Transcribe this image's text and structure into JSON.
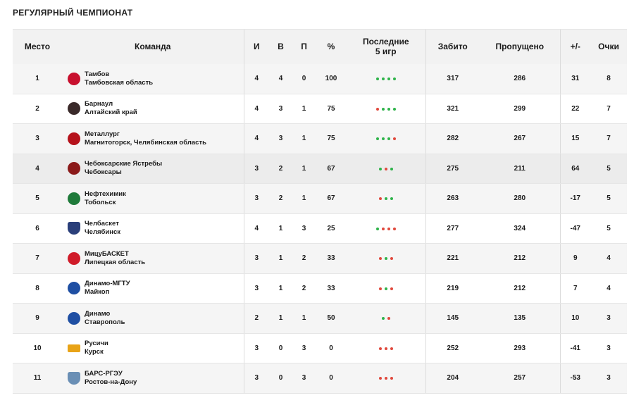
{
  "page": {
    "title": "РЕГУЛЯРНЫЙ ЧЕМПИОНАТ"
  },
  "colors": {
    "win": "#2eb34a",
    "loss": "#e0483c",
    "header_bg": "#f2f2f2"
  },
  "table": {
    "headers": {
      "place": "Место",
      "team": "Команда",
      "games": "И",
      "wins": "В",
      "losses": "П",
      "pct": "%",
      "last5_line1": "Последние",
      "last5_line2": "5 игр",
      "scored": "Забито",
      "conceded": "Пропущено",
      "diff": "+/-",
      "points": "Очки"
    },
    "rows": [
      {
        "place": "1",
        "name": "Тамбов",
        "region": "Тамбовская область",
        "logo_icon": "tambov-logo-icon",
        "logo_color": "#c8102e",
        "logo_bg": "#ffffff",
        "games": "4",
        "wins": "4",
        "losses": "0",
        "pct": "100",
        "form": [
          "w",
          "w",
          "w",
          "w"
        ],
        "scored": "317",
        "conceded": "286",
        "diff": "31",
        "points": "8"
      },
      {
        "place": "2",
        "name": "Барнаул",
        "region": "Алтайский край",
        "logo_icon": "barnaul-logo-icon",
        "logo_color": "#3a2a2a",
        "logo_bg": "#ffffff",
        "games": "4",
        "wins": "3",
        "losses": "1",
        "pct": "75",
        "form": [
          "l",
          "w",
          "w",
          "w"
        ],
        "scored": "321",
        "conceded": "299",
        "diff": "22",
        "points": "7"
      },
      {
        "place": "3",
        "name": "Металлург",
        "region": "Магнитогорск, Челябинская область",
        "logo_icon": "metallurg-logo-icon",
        "logo_color": "#b5121b",
        "logo_bg": "#ffffff",
        "games": "4",
        "wins": "3",
        "losses": "1",
        "pct": "75",
        "form": [
          "w",
          "w",
          "w",
          "l"
        ],
        "scored": "282",
        "conceded": "267",
        "diff": "15",
        "points": "7"
      },
      {
        "place": "4",
        "name": "Чебоксарские Ястребы",
        "region": "Чебоксары",
        "logo_icon": "cheboksary-hawks-logo-icon",
        "logo_color": "#8b1a1a",
        "logo_bg": "#ffffff",
        "games": "3",
        "wins": "2",
        "losses": "1",
        "pct": "67",
        "form": [
          "w",
          "l",
          "w"
        ],
        "scored": "275",
        "conceded": "211",
        "diff": "64",
        "points": "5"
      },
      {
        "place": "5",
        "name": "Нефтехимик",
        "region": "Тобольск",
        "logo_icon": "neftekhimik-logo-icon",
        "logo_color": "#1f7a3a",
        "logo_bg": "#ffffff",
        "games": "3",
        "wins": "2",
        "losses": "1",
        "pct": "67",
        "form": [
          "l",
          "w",
          "w"
        ],
        "scored": "263",
        "conceded": "280",
        "diff": "-17",
        "points": "5"
      },
      {
        "place": "6",
        "name": "Челбаскет",
        "region": "Челябинск",
        "logo_icon": "chelbasket-logo-icon",
        "logo_color": "#2a3f7a",
        "logo_bg": "#ffffff",
        "games": "4",
        "wins": "1",
        "losses": "3",
        "pct": "25",
        "form": [
          "w",
          "l",
          "l",
          "l"
        ],
        "scored": "277",
        "conceded": "324",
        "diff": "-47",
        "points": "5"
      },
      {
        "place": "7",
        "name": "МицуБАСКЕТ",
        "region": "Липецкая область",
        "logo_icon": "mitsubasket-logo-icon",
        "logo_color": "#d01c2a",
        "logo_bg": "#ffffff",
        "games": "3",
        "wins": "1",
        "losses": "2",
        "pct": "33",
        "form": [
          "l",
          "w",
          "l"
        ],
        "scored": "221",
        "conceded": "212",
        "diff": "9",
        "points": "4"
      },
      {
        "place": "8",
        "name": "Динамо-МГТУ",
        "region": "Майкоп",
        "logo_icon": "dynamo-mgtu-logo-icon",
        "logo_color": "#1f4fa3",
        "logo_bg": "#ffffff",
        "games": "3",
        "wins": "1",
        "losses": "2",
        "pct": "33",
        "form": [
          "l",
          "w",
          "l"
        ],
        "scored": "219",
        "conceded": "212",
        "diff": "7",
        "points": "4"
      },
      {
        "place": "9",
        "name": "Динамо",
        "region": "Ставрополь",
        "logo_icon": "dynamo-stavropol-logo-icon",
        "logo_color": "#1f4fa3",
        "logo_bg": "#ffffff",
        "games": "2",
        "wins": "1",
        "losses": "1",
        "pct": "50",
        "form": [
          "w",
          "l"
        ],
        "scored": "145",
        "conceded": "135",
        "diff": "10",
        "points": "3"
      },
      {
        "place": "10",
        "name": "Русичи",
        "region": "Курск",
        "logo_icon": "rusichi-logo-icon",
        "logo_color": "#e8a317",
        "logo_bg": "#ffffff",
        "games": "3",
        "wins": "0",
        "losses": "3",
        "pct": "0",
        "form": [
          "l",
          "l",
          "l"
        ],
        "scored": "252",
        "conceded": "293",
        "diff": "-41",
        "points": "3"
      },
      {
        "place": "11",
        "name": "БАРС-РГЭУ",
        "region": "Ростов-на-Дону",
        "logo_icon": "bars-rgeu-logo-icon",
        "logo_color": "#6a8fb5",
        "logo_bg": "#ffffff",
        "games": "3",
        "wins": "0",
        "losses": "3",
        "pct": "0",
        "form": [
          "l",
          "l",
          "l"
        ],
        "scored": "204",
        "conceded": "257",
        "diff": "-53",
        "points": "3"
      }
    ]
  }
}
